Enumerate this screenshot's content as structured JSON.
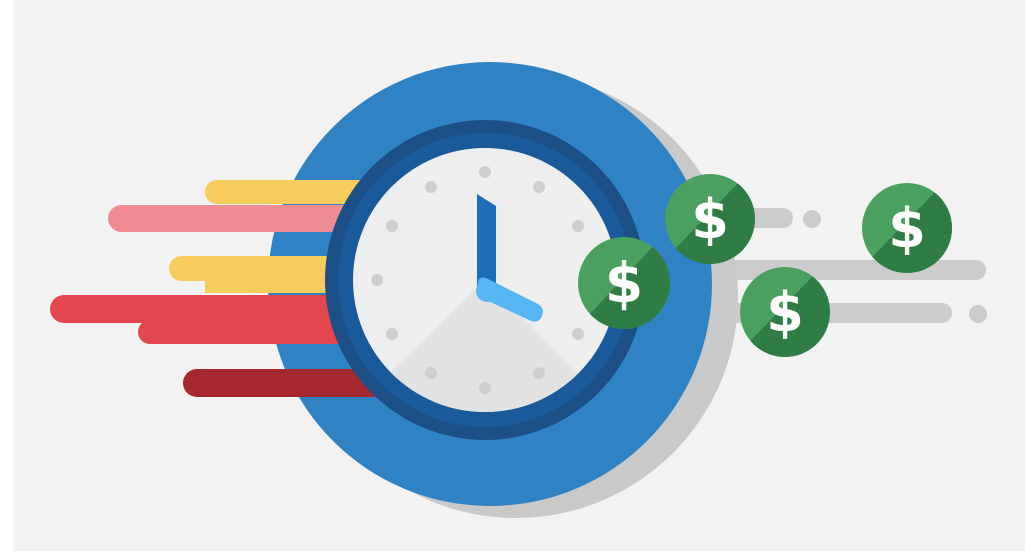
{
  "illustration": {
    "subject": "clock-with-money",
    "coin_symbol": "$",
    "coin_count": 4,
    "clock_time": "4:00",
    "colors": {
      "background": "#f2f2f2",
      "ring_outer": "#2f83c5",
      "ring_inner": "#1c4f86",
      "clock_face": "#eeeeee",
      "hour_hand": "#1f6fb8",
      "minute_hand": "#56b5f3",
      "coin_light": "#4aa05e",
      "coin_dark": "#2f7d45",
      "streak_yellow": "#f6cc5c",
      "streak_pink": "#ef8b93",
      "streak_red": "#e2464f",
      "streak_darkred": "#a5282f",
      "streak_gray": "#cccccc"
    }
  }
}
